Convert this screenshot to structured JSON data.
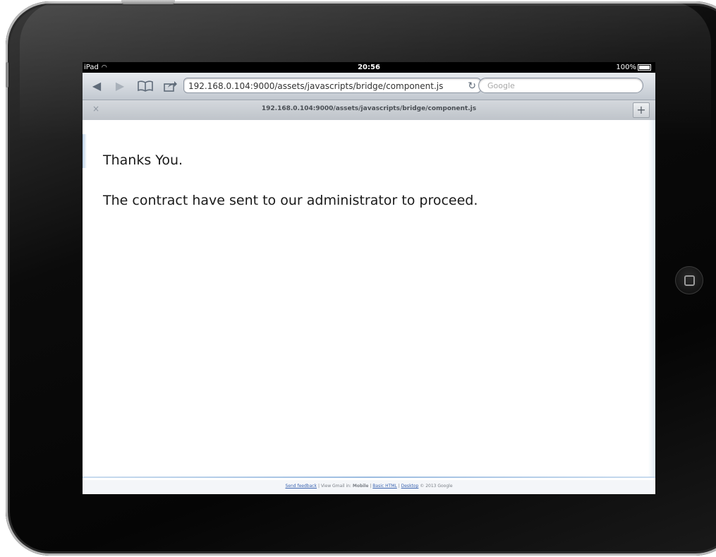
{
  "status_bar": {
    "device": "iPad",
    "wifi_icon": "wifi-icon",
    "time": "20:56",
    "battery": "100%"
  },
  "toolbar": {
    "back_icon": "◀",
    "forward_icon": "▶",
    "bookmarks_icon": "book-icon",
    "share_icon": "share-icon",
    "url": "192.168.0.104:9000/assets/javascripts/bridge/component.js",
    "reload_icon": "↻",
    "search_placeholder": "Google"
  },
  "tab": {
    "close": "×",
    "title": "192.168.0.104:9000/assets/javascripts/bridge/component.js",
    "new_tab": "+"
  },
  "page": {
    "heading": "Thanks You.",
    "message": "The contract have sent to our administrator to proceed."
  },
  "footer": {
    "send_feedback": "Send feedback",
    "sep1": " | ",
    "view_in": "View Gmail in: ",
    "mobile": "Mobile",
    "sep2": " | ",
    "basic_html": "Basic HTML",
    "sep3": " | ",
    "desktop": "Desktop",
    "copyright": " © 2013 Google"
  }
}
